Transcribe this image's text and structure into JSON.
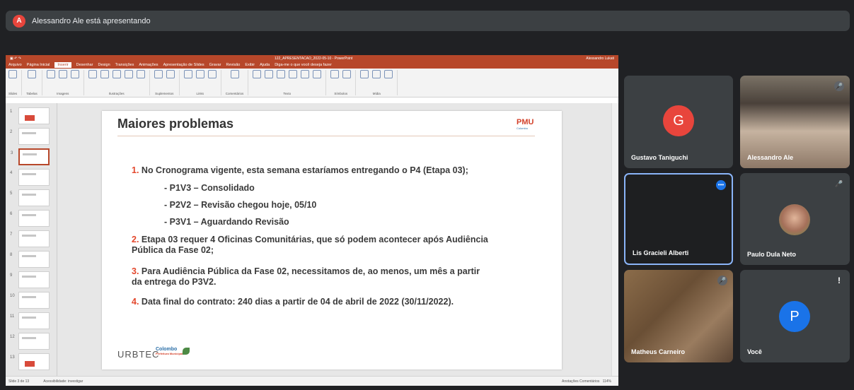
{
  "banner": {
    "avatar_letter": "A",
    "text": "Alessandro Ale está apresentando"
  },
  "ppt": {
    "window_title": "122_APRESENTACAO_2022-05-10 - PowerPoint",
    "user": "Alessandro Lukati",
    "tabs": [
      "Arquivo",
      "Página Inicial",
      "Inserir",
      "Desenhar",
      "Design",
      "Transições",
      "Animações",
      "Apresentação de Slides",
      "Gravar",
      "Revisão",
      "Exibir",
      "Ajuda",
      "Diga-me o que você deseja fazer"
    ],
    "active_tab": "Inserir",
    "ribbon_groups": [
      "Slides",
      "Tabelas",
      "Imagens",
      "Ilustrações",
      "Suplementos",
      "Links",
      "Comentários",
      "Texto",
      "Símbolos",
      "Mídia"
    ],
    "thumb_numbers": [
      "1",
      "2",
      "3",
      "4",
      "5",
      "6",
      "7",
      "8",
      "9",
      "10",
      "11",
      "12",
      "13"
    ],
    "status_left": "Slide 3 de 13",
    "status_access": "Acessibilidade: investigar",
    "status_right": "Anotações   Comentários",
    "zoom": "114%"
  },
  "slide": {
    "title": "Maiores problemas",
    "logo": "PMU",
    "logo_sub": "Colombo",
    "items": [
      {
        "num": "1.",
        "text": "No Cronograma vigente, esta semana estaríamos entregando o P4 (Etapa 03);"
      },
      {
        "num": "2.",
        "text": "Etapa 03 requer 4 Oficinas Comunitárias, que só podem acontecer após Audiência Pública da Fase 02;"
      },
      {
        "num": "3.",
        "text": "Para Audiência Pública da Fase 02, necessitamos de, ao menos, um mês a partir da entrega do P3V2."
      },
      {
        "num": "4.",
        "text": "Data final do contrato: 240 dias a partir de 04 de abril de 2022 (30/11/2022)."
      }
    ],
    "subitems": [
      "- P1V3 – Consolidado",
      "- P2V2 – Revisão chegou hoje, 05/10",
      "- P3V1 – Aguardando Revisão"
    ],
    "footer_urbtec": "URBTEC",
    "footer_colombo": "Colombo",
    "footer_colombo_sub": "Prefeitura Municipal"
  },
  "participants": [
    {
      "name": "Gustavo Taniguchi",
      "letter": "G",
      "color": "#e8453c"
    },
    {
      "name": "Alessandro Ale"
    },
    {
      "name": "Lis Gracieli Alberti"
    },
    {
      "name": "Paulo Dula Neto"
    },
    {
      "name": "Matheus Carneiro"
    },
    {
      "name": "Você",
      "letter": "P",
      "color": "#1a73e8"
    }
  ]
}
